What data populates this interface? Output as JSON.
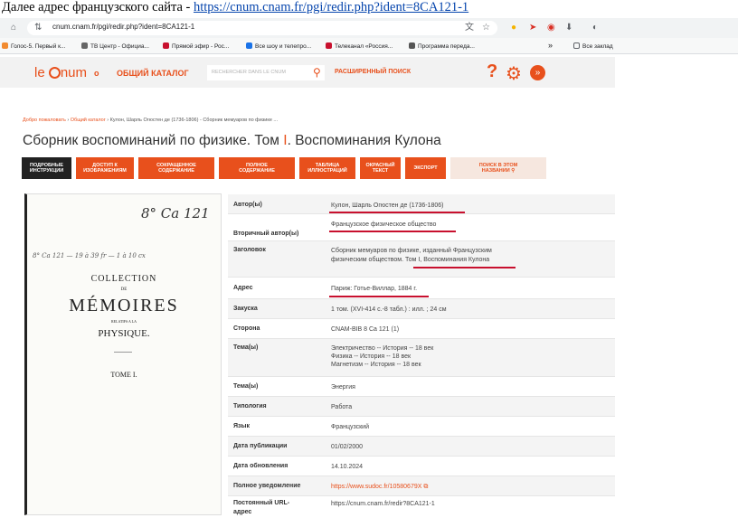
{
  "caption": {
    "text": "Далее адрес французского сайта - ",
    "link": "https://cnum.cnam.fr/pgi/redir.php?ident=8CA121-1"
  },
  "browser": {
    "url": "cnum.cnam.fr/pgi/redir.php?ident=8CA121-1",
    "bookmarks": [
      "Голос-5. Первый к...",
      "ТВ Центр - Официа...",
      "Прямой эфир - Рос...",
      "Все шоу и телепро...",
      "Телеканал «Россия...",
      "Программа переда..."
    ],
    "more": "»",
    "all_bookmarks": "Все заклад"
  },
  "header": {
    "logo": "le cnum",
    "o_label": "o",
    "catalog": "ОБЩИЙ КАТАЛОГ",
    "search_placeholder": "RECHERCHER DANS LE CNUM",
    "advanced_search": "РАСШИРЕННЫЙ ПОИСК"
  },
  "breadcrumb": {
    "home": "Добро пожаловать",
    "catalog": "Общий каталог",
    "current": "Кулон, Шарль Огюстен де (1736-1806) - Сборник мемуаров по физике ..."
  },
  "title": {
    "part1": "Сборник воспоминаний по физике. Том ",
    "sep": "I",
    "part2": ". Воспоминания Кулона"
  },
  "tabs": [
    {
      "line1": "ПОДРОБНЫЕ",
      "line2": "ИНСТРУКЦИИ"
    },
    {
      "line1": "ДОСТУП К",
      "line2": "ИЗОБРАЖЕНИЯМ"
    },
    {
      "line1": "СОКРАЩЕННОЕ",
      "line2": "СОДЕРЖАНИЕ"
    },
    {
      "line1": "ПОЛНОЕ",
      "line2": "СОДЕРЖАНИЕ"
    },
    {
      "line1": "ТАБЛИЦА",
      "line2": "ИЛЛЮСТРАЦИЙ"
    },
    {
      "line1": "ОКРАСНЫЙ",
      "line2": "ТЕКСТ"
    },
    {
      "line1": "ЭКСПОРТ",
      "line2": ""
    },
    {
      "line1": "ПОИСК В ЭТОМ",
      "line2": "НАЗВАНИИ"
    }
  ],
  "book": {
    "shelfmark": "8° Ca 121",
    "handnote": "8° Ca 121 — 19 à 39 fr — 1 à 10 cx",
    "collection": "COLLECTION",
    "de": "DE",
    "memoires": "MÉMOIRES",
    "relatifs": "RELATIFS A LA",
    "physique": "PHYSIQUE.",
    "tome": "TOME I."
  },
  "details": {
    "author_label": "Автор(ы)",
    "author": "Кулон, Шарль Огюстен де (1736-1806)",
    "secondary_label": "Вторичный автор(ы)",
    "secondary": "Французское физическое общество",
    "heading_label": "Заголовок",
    "heading1": "Сборник мемуаров по физике, изданный Французским",
    "heading2": "физическим обществом. Том I, Воспоминания Кулона",
    "address_label": "Адрес",
    "address": "Париж: Готье-Виллар, 1884 г.",
    "load_label": "Закуска",
    "load": "1 том. (XVI-414 с.-8 табл.) : илл. ; 24 см",
    "side_label": "Сторона",
    "side": "CNAM-BIB 8 Ca 121 (1)",
    "topics_label": "Тема(ы)",
    "topic1": "Электричество -- История -- 18 век",
    "topic2": "Физика -- История -- 18 век",
    "topic3": "Магнетизм -- История -- 18 век",
    "topic_b_label": "Тема(ы)",
    "topic_b": "Энергия",
    "typology_label": "Типология",
    "typology": "Работа",
    "lang_label": "Язык",
    "lang": "Французский",
    "pub_label": "Дата публикации",
    "pub": "01/02/2000",
    "upd_label": "Дата обновления",
    "upd": "14.10.2024",
    "notice_label": "Полное уведомление",
    "notice": "https://www.sudoc.fr/10580679X",
    "url_label1": "Постоянный URL-",
    "url_label2": "адрес",
    "url": "https://cnum.cnam.fr/redir?8CA121-1"
  }
}
